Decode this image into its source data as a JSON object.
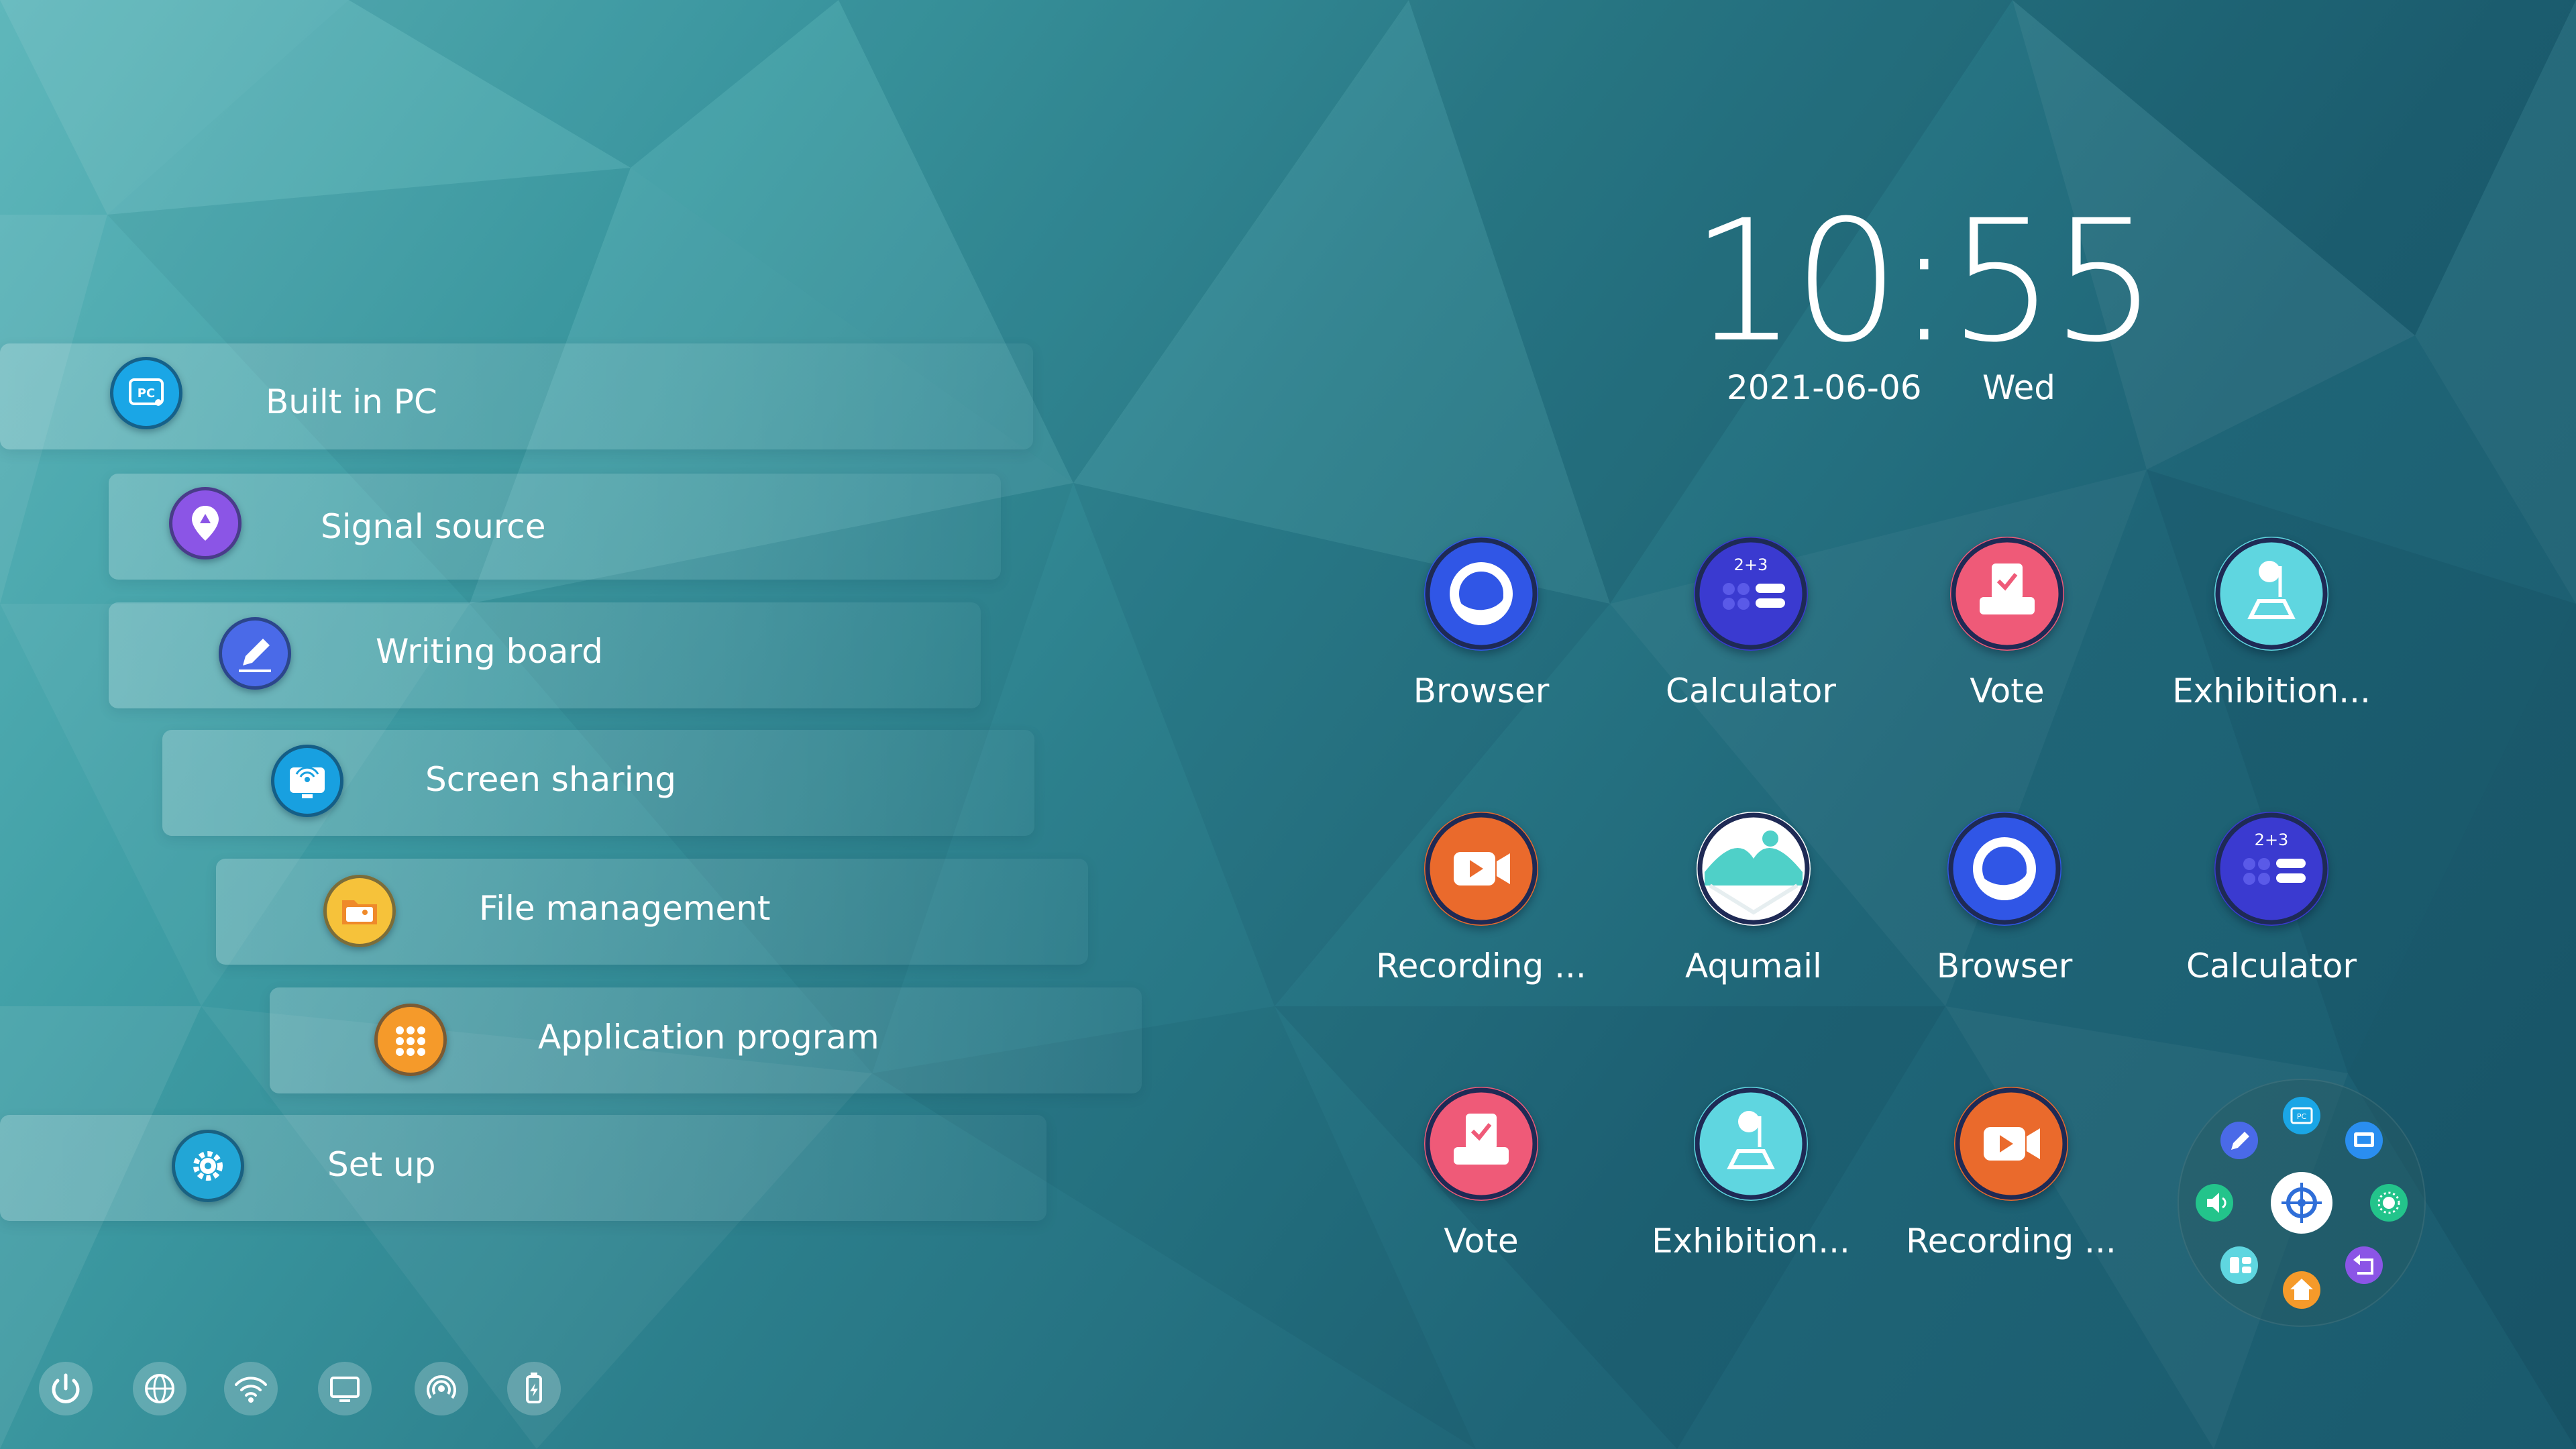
{
  "clock": {
    "time": "10:55",
    "date": "2021-06-06",
    "day": "Wed"
  },
  "menu": {
    "items": [
      {
        "label": "Built in PC",
        "icon": "pc-icon",
        "color": "#1aa6e6"
      },
      {
        "label": "Signal source",
        "icon": "signal-source-icon",
        "color": "#8b55e6"
      },
      {
        "label": "Writing board",
        "icon": "pen-icon",
        "color": "#4a6ae8"
      },
      {
        "label": "Screen sharing",
        "icon": "screen-share-icon",
        "color": "#18a0e0"
      },
      {
        "label": "File management",
        "icon": "folder-icon",
        "color": "#f6c23a"
      },
      {
        "label": "Application program",
        "icon": "apps-grid-icon",
        "color": "#f59a2a"
      },
      {
        "label": "Set up",
        "icon": "gear-icon",
        "color": "#22a6d6"
      }
    ]
  },
  "apps": [
    {
      "label": "Browser",
      "icon": "browser-icon",
      "color": "#3056e6"
    },
    {
      "label": "Calculator",
      "icon": "calculator-icon",
      "color": "#3a3ad0"
    },
    {
      "label": "Vote",
      "icon": "vote-icon",
      "color": "#ef5a78"
    },
    {
      "label": "Exhibition...",
      "icon": "exhibition-icon",
      "color": "#5fd6e0"
    },
    {
      "label": "Recording ...",
      "icon": "recording-icon",
      "color": "#ea6a2c"
    },
    {
      "label": "Aqumail",
      "icon": "mail-icon",
      "color": "#4fd0c8"
    },
    {
      "label": "Browser",
      "icon": "browser-icon",
      "color": "#3056e6"
    },
    {
      "label": "Calculator",
      "icon": "calculator-icon",
      "color": "#3a3ad0"
    },
    {
      "label": "Vote",
      "icon": "vote-icon",
      "color": "#ef5a78"
    },
    {
      "label": "Exhibition...",
      "icon": "exhibition-icon",
      "color": "#5fd6e0"
    },
    {
      "label": "Recording ...",
      "icon": "recording-icon",
      "color": "#ea6a2c"
    }
  ],
  "calculator_badge": "2+3",
  "radial_menu": {
    "center_icon": "settings-wheel-icon",
    "pc_badge": "PC",
    "items": [
      "pc-icon",
      "whiteboard-icon",
      "brightness-icon",
      "back-icon",
      "home-icon",
      "split-screen-icon",
      "volume-icon",
      "pen-icon"
    ]
  },
  "system_bar": {
    "items": [
      "power-icon",
      "network-icon",
      "wifi-icon",
      "display-icon",
      "hotspot-icon",
      "usb-icon"
    ]
  },
  "colors": {
    "text": "#ffffff",
    "background_start": "#5fb7bb",
    "background_end": "#1a5a6d"
  }
}
